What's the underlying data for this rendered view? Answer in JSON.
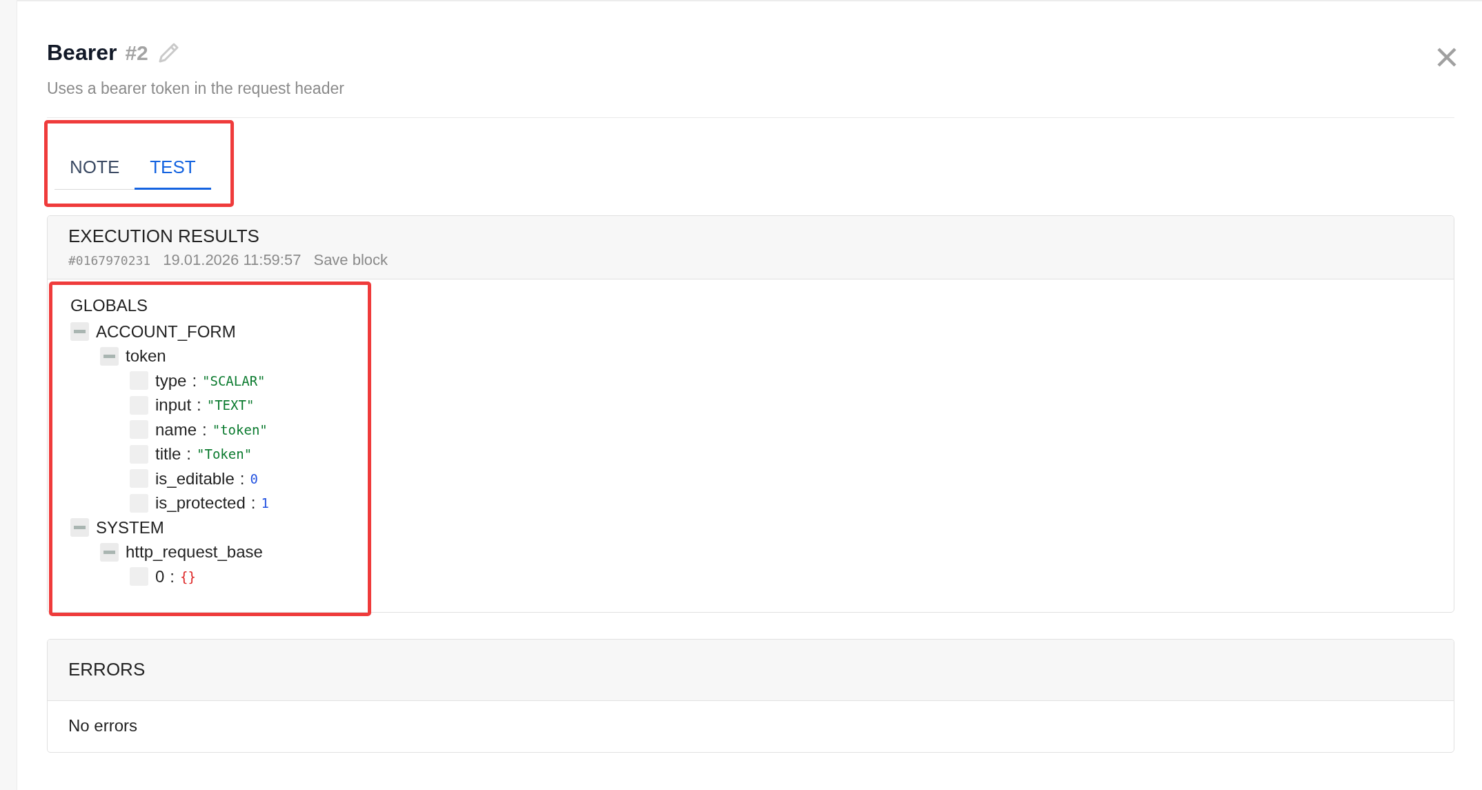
{
  "panel": {
    "title": "Bearer",
    "number": "#2",
    "description": "Uses a bearer token in the request header"
  },
  "tabs_highlighted": true,
  "tabs": [
    {
      "label": "NOTE",
      "selected": false
    },
    {
      "label": "TEST",
      "selected": true
    }
  ],
  "execution_results": {
    "title": "EXECUTION RESULTS",
    "run_id": "#0167970231",
    "timestamp": "19.01.2026 11:59:57",
    "action": "Save block",
    "globals_highlighted": true,
    "globals_title": "GLOBALS",
    "tree": [
      {
        "kind": "group",
        "label": "ACCOUNT_FORM",
        "expanded": true,
        "children": [
          {
            "kind": "group",
            "label": "token",
            "expanded": true,
            "children": [
              {
                "kind": "leaf",
                "key": "type",
                "separator": ":",
                "value": "\"SCALAR\"",
                "color": "#0a7a2e"
              },
              {
                "kind": "leaf",
                "key": "input",
                "separator": ":",
                "value": "\"TEXT\"",
                "color": "#0a7a2e"
              },
              {
                "kind": "leaf",
                "key": "name",
                "separator": ":",
                "value": "\"token\"",
                "color": "#0a7a2e"
              },
              {
                "kind": "leaf",
                "key": "title",
                "separator": ":",
                "value": "\"Token\"",
                "color": "#0a7a2e"
              },
              {
                "kind": "leaf",
                "key": "is_editable",
                "separator": ":",
                "value": "0",
                "color": "#1f4fe0"
              },
              {
                "kind": "leaf",
                "key": "is_protected",
                "separator": ":",
                "value": "1",
                "color": "#1f4fe0"
              }
            ]
          }
        ]
      },
      {
        "kind": "group",
        "label": "SYSTEM",
        "expanded": true,
        "children": [
          {
            "kind": "group",
            "label": "http_request_base",
            "expanded": true,
            "children": [
              {
                "kind": "leaf",
                "key": "0",
                "separator": ":",
                "value": "{}",
                "color": "#dd2222"
              }
            ]
          }
        ]
      }
    ]
  },
  "errors": {
    "title": "ERRORS",
    "message": "No errors"
  }
}
